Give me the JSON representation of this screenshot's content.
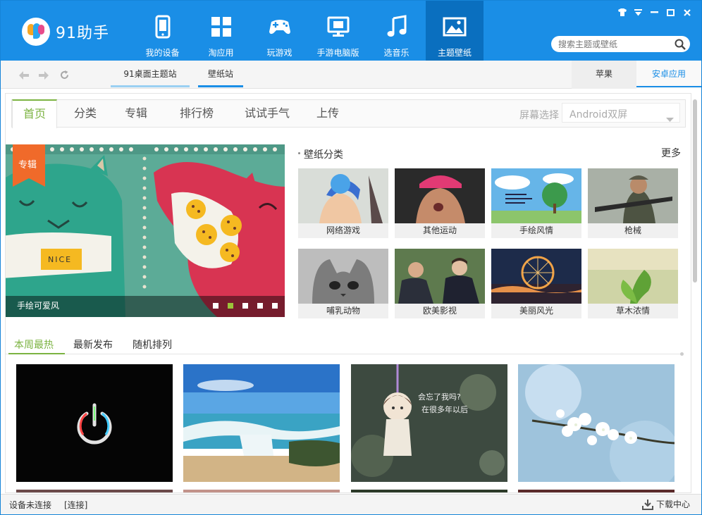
{
  "app": {
    "logo_text": "91助手"
  },
  "nav": [
    {
      "label": "我的设备",
      "icon": "phone-icon"
    },
    {
      "label": "淘应用",
      "icon": "apps-grid-icon"
    },
    {
      "label": "玩游戏",
      "icon": "gamepad-icon"
    },
    {
      "label": "手游电脑版",
      "icon": "monitor-icon"
    },
    {
      "label": "选音乐",
      "icon": "music-note-icon"
    },
    {
      "label": "主题壁纸",
      "icon": "picture-icon",
      "active": true
    }
  ],
  "search": {
    "placeholder": "搜索主题或壁纸"
  },
  "subbar": {
    "tabs": [
      "91桌面主题站",
      "壁纸站"
    ],
    "active_tab": "壁纸站",
    "platforms": [
      "苹果",
      "安卓应用"
    ],
    "active_platform": "安卓应用"
  },
  "page_tabs": [
    "首页",
    "分类",
    "专辑",
    "排行榜",
    "试试手气",
    "上传"
  ],
  "active_page_tab": "首页",
  "screen": {
    "label": "屏幕选择",
    "value": "Android双屏"
  },
  "banner": {
    "tag": "专辑",
    "caption": "手绘可爱风",
    "sign_text": "NICE",
    "dots": 5,
    "active_dot": 2
  },
  "categories": {
    "title": "壁纸分类",
    "more": "更多",
    "items": [
      "网络游戏",
      "其他运动",
      "手绘风情",
      "枪械",
      "哺乳动物",
      "欧美影视",
      "美丽风光",
      "草木浓情"
    ]
  },
  "rank": {
    "tabs": [
      "本周最热",
      "最新发布",
      "随机排列"
    ],
    "active": "本周最热"
  },
  "wallpapers": [
    {
      "name": "power-button-wallpaper"
    },
    {
      "name": "beach-waterfall-wallpaper"
    },
    {
      "name": "doll-keychain-wallpaper",
      "text_line1": "会忘了我吗?",
      "text_line2": "在很多年以后"
    },
    {
      "name": "cherry-blossom-wallpaper"
    }
  ],
  "status": {
    "device": "设备未连接",
    "connect": "[连接]",
    "download": "下载中心"
  },
  "colors": {
    "header_blue": "#1a8ee6",
    "active_nav": "#0a6fbf",
    "accent_green": "#7cb342",
    "tag_orange": "#f06a2a"
  }
}
